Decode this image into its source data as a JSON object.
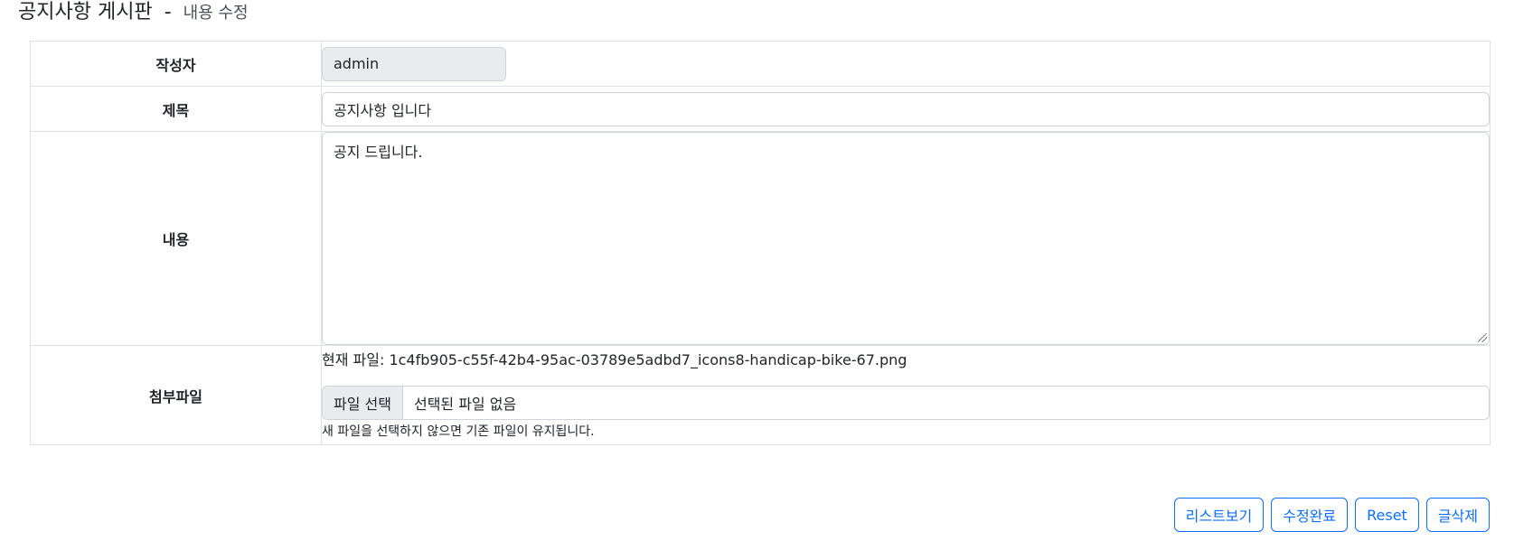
{
  "header": {
    "title": "공지사항 게시판",
    "separator": "-",
    "subtitle": "내용 수정"
  },
  "form": {
    "rows": {
      "author": {
        "label": "작성자",
        "value": "admin"
      },
      "title": {
        "label": "제목",
        "value": "공지사항 입니다"
      },
      "content": {
        "label": "내용",
        "value": "공지 드립니다."
      },
      "attachment": {
        "label": "첨부파일",
        "current_file": "현재 파일: 1c4fb905-c55f-42b4-95ac-03789e5adbd7_icons8-handicap-bike-67.png",
        "choose_button": "파일 선택",
        "no_file": "선택된 파일 없음",
        "help": "새 파일을 선택하지 않으면 기존 파일이 유지됩니다."
      }
    }
  },
  "actions": {
    "list": "리스트보기",
    "submit": "수정완료",
    "reset": "Reset",
    "delete": "글삭제"
  },
  "colors": {
    "primary": "#0d6efd",
    "border": "#dee2e6",
    "readonly_bg": "#e9ecef"
  }
}
